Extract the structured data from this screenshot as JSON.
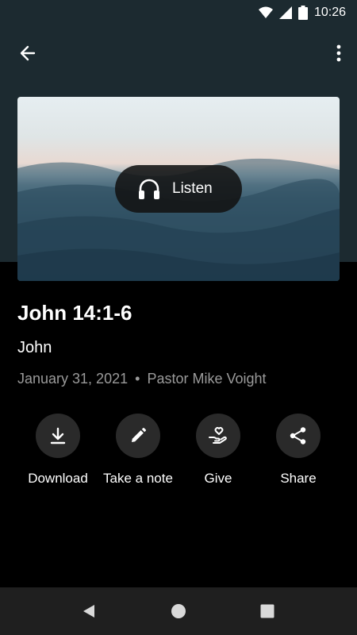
{
  "status_bar": {
    "time": "10:26",
    "icons": [
      "wifi-icon",
      "signal-icon",
      "battery-icon"
    ]
  },
  "app_bar": {
    "back_icon": "arrow-left-icon",
    "more_icon": "more-vert-icon"
  },
  "hero": {
    "listen_label": "Listen",
    "listen_icon": "headphones-icon"
  },
  "sermon": {
    "title": "John 14:1-6",
    "series": "John",
    "date": "January 31, 2021",
    "separator": "•",
    "speaker": "Pastor Mike Voight"
  },
  "actions": [
    {
      "label": "Download",
      "icon": "download-icon"
    },
    {
      "label": "Take a note",
      "icon": "pencil-icon"
    },
    {
      "label": "Give",
      "icon": "heart-hand-icon"
    },
    {
      "label": "Share",
      "icon": "share-icon"
    }
  ],
  "nav_bar": {
    "icons": [
      "nav-back-icon",
      "nav-home-icon",
      "nav-recents-icon"
    ]
  },
  "colors": {
    "header_bg": "#1c2a30",
    "body_bg": "#000000",
    "button_bg": "#2a2a2a",
    "meta_text": "#9a9a9a",
    "nav_bg": "#1f1f1f"
  }
}
